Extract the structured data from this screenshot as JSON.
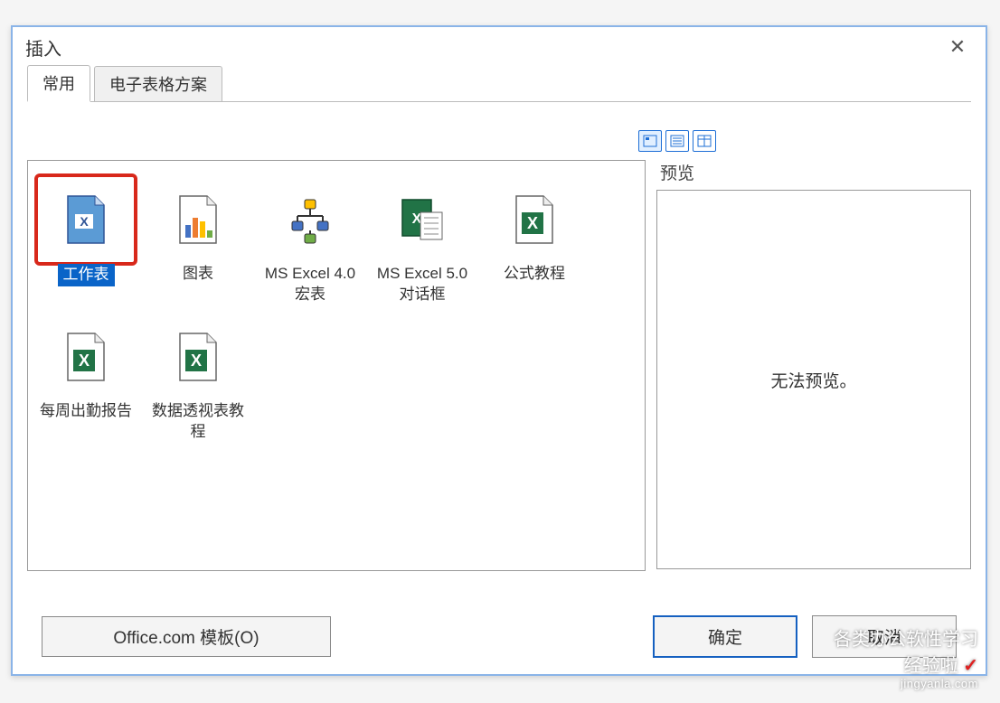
{
  "dialog": {
    "title": "插入",
    "tabs": [
      {
        "label": "常用",
        "active": true
      },
      {
        "label": "电子表格方案",
        "active": false
      }
    ],
    "templates": [
      {
        "id": "worksheet",
        "label": "工作表",
        "selected": true,
        "icon": "worksheet-doc"
      },
      {
        "id": "chart",
        "label": "图表",
        "selected": false,
        "icon": "chart"
      },
      {
        "id": "macro4",
        "label": "MS Excel 4.0 宏表",
        "selected": false,
        "icon": "orgchart"
      },
      {
        "id": "dialog5",
        "label": "MS Excel 5.0 对话框",
        "selected": false,
        "icon": "form"
      },
      {
        "id": "formula",
        "label": "公式教程",
        "selected": false,
        "icon": "excel-x"
      },
      {
        "id": "weekly",
        "label": "每周出勤报告",
        "selected": false,
        "icon": "excel-x"
      },
      {
        "id": "pivot",
        "label": "数据透视表教程",
        "selected": false,
        "icon": "excel-x"
      }
    ],
    "preview": {
      "label": "预览",
      "message": "无法预览。"
    },
    "view_modes": [
      {
        "name": "large-icons",
        "active": true
      },
      {
        "name": "list",
        "active": false
      },
      {
        "name": "details",
        "active": false
      }
    ],
    "buttons": {
      "office": "Office.com 模板(O)",
      "ok": "确定",
      "cancel": "取消"
    }
  },
  "watermark": {
    "line1": "各类办公软性学习",
    "line2": "经验啦",
    "url": "jingyanla.com"
  }
}
